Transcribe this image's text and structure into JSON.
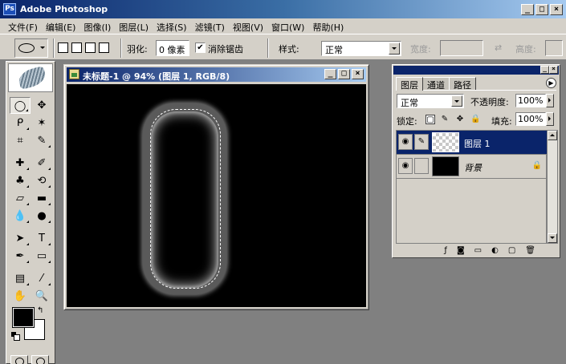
{
  "app": {
    "title": "Adobe Photoshop",
    "logo_text": "Ps"
  },
  "window_buttons": {
    "minimize": "_",
    "maximize": "□",
    "close": "×"
  },
  "menu": [
    "文件(F)",
    "编辑(E)",
    "图像(I)",
    "图层(L)",
    "选择(S)",
    "滤镜(T)",
    "视图(V)",
    "窗口(W)",
    "帮助(H)"
  ],
  "options": {
    "feather_label": "羽化:",
    "feather_value": "0 像素",
    "antialias_label": "消除锯齿",
    "antialias_check": "✔",
    "style_label": "样式:",
    "style_value": "正常",
    "width_label": "宽度:",
    "swap_icon": "⇄",
    "height_label": "高度:"
  },
  "document": {
    "title": "未标题-1 @ 94% (图层 1, RGB/8)"
  },
  "tools": [
    {
      "name": "marquee",
      "glyph": "◯",
      "active": true
    },
    {
      "name": "move",
      "glyph": "✥"
    },
    {
      "name": "lasso",
      "glyph": "ᑭ"
    },
    {
      "name": "magic-wand",
      "glyph": "✶"
    },
    {
      "name": "crop",
      "glyph": "⌗"
    },
    {
      "name": "slice",
      "glyph": "✎"
    },
    {
      "name": "healing",
      "glyph": "✚"
    },
    {
      "name": "brush",
      "glyph": "✐"
    },
    {
      "name": "stamp",
      "glyph": "♣"
    },
    {
      "name": "history-brush",
      "glyph": "⟲"
    },
    {
      "name": "eraser",
      "glyph": "▱"
    },
    {
      "name": "gradient",
      "glyph": "▬"
    },
    {
      "name": "blur",
      "glyph": "💧"
    },
    {
      "name": "dodge",
      "glyph": "●"
    },
    {
      "name": "path-select",
      "glyph": "➤"
    },
    {
      "name": "type",
      "glyph": "T"
    },
    {
      "name": "pen",
      "glyph": "✒"
    },
    {
      "name": "shape",
      "glyph": "▭"
    },
    {
      "name": "notes",
      "glyph": "▤"
    },
    {
      "name": "eyedropper",
      "glyph": "⁄"
    },
    {
      "name": "hand",
      "glyph": "✋"
    },
    {
      "name": "zoom",
      "glyph": "🔍"
    }
  ],
  "colors": {
    "foreground": "#000000",
    "background": "#ffffff",
    "swap_glyph": "↰"
  },
  "layers_panel": {
    "tabs": [
      "图层",
      "通道",
      "路径"
    ],
    "menu_glyph": "▶",
    "blend_mode": "正常",
    "opacity_label": "不透明度:",
    "opacity_value": "100%",
    "lock_label": "锁定:",
    "fill_label": "填充:",
    "fill_value": "100%",
    "lock_icons": [
      "▢",
      "✎",
      "✥",
      "🔒"
    ],
    "layers": [
      {
        "name": "图层 1",
        "selected": true,
        "eye": "◉",
        "thumb": "transparent"
      },
      {
        "name": "背景",
        "selected": false,
        "eye": "◉",
        "thumb": "black",
        "italic": true,
        "locked": true,
        "lock_glyph": "🔒"
      }
    ],
    "bottom_buttons": [
      "ƒ",
      "◙",
      "▭",
      "◐",
      "▢",
      "🗑"
    ]
  }
}
